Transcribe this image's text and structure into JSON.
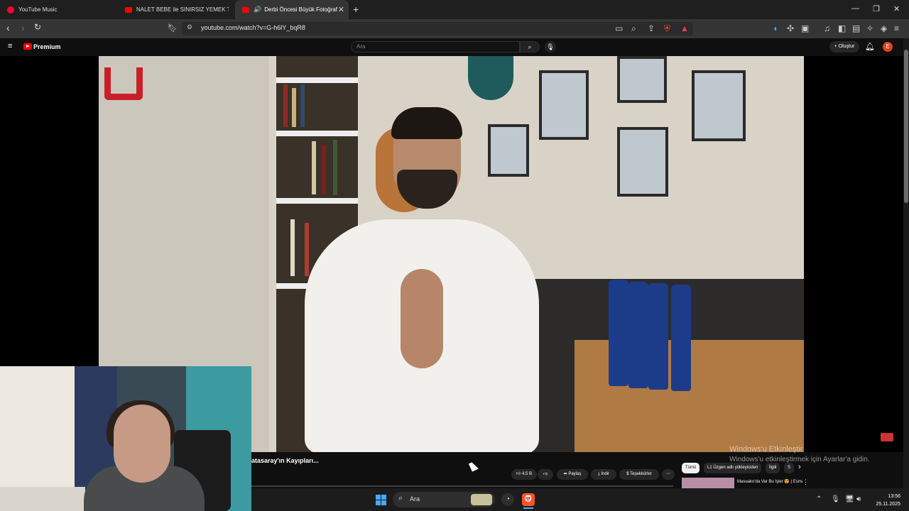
{
  "browser": {
    "tabs": [
      {
        "title": "YouTube Music",
        "active": false
      },
      {
        "title": "NALET BEBE ile SINIRSIZ YEMEK TUR",
        "active": false
      },
      {
        "title": "Derbi Öncesi Büyük Fotoğraf",
        "active": true
      }
    ],
    "url": "youtube.com/watch?v=G-h6lY_bqR8"
  },
  "youtube": {
    "logo_label": "Premium",
    "search_placeholder": "Ara",
    "create_label": "Oluştur",
    "avatar_letter": "E",
    "video_title_partial": "atasaray'ın Kayıpları...",
    "like_count": "4,5 B",
    "share_label": "Paylaş",
    "download_label": "İndir",
    "thanks_label": "Teşekkürler",
    "chips": [
      "Tümü",
      "L1 Üzgen adlı yükleyiciden",
      "İlgili",
      "S"
    ],
    "rec_title": "Masuako'da Var Bu İşler 😍 | Esman Yaşar, Can Özdemir..."
  },
  "watermark": {
    "line1": "Windows'u Etkinleştir",
    "line2": "Windows'u etkinleştirmek için Ayarlar'a gidin."
  },
  "taskbar": {
    "search_label": "Ara",
    "time": "13:56",
    "date": "25.11.2025"
  },
  "colors": {
    "youtube_red": "#ff0000",
    "brave_orange": "#fb542b",
    "accent_blue": "#4aa8ff"
  }
}
